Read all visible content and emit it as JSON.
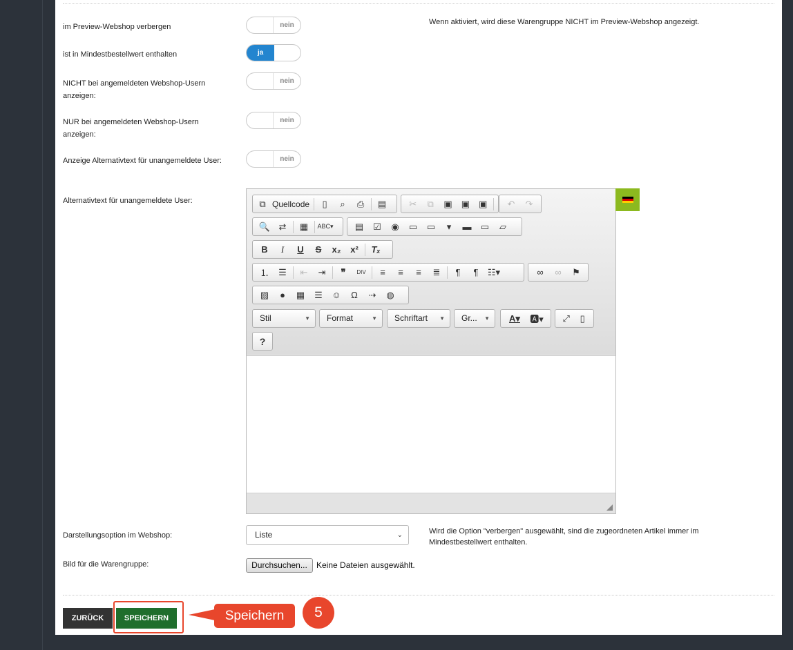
{
  "fields": {
    "preview_hide": {
      "label": "im Preview-Webshop verbergen",
      "value": "nein",
      "hint": "Wenn aktiviert, wird diese Warengruppe NICHT im Preview-Webshop angezeigt."
    },
    "min_order": {
      "label": "ist in Mindestbestellwert enthalten",
      "value": "ja"
    },
    "not_logged": {
      "label": "NICHT bei angemeldeten Webshop-Usern anzeigen:",
      "value": "nein"
    },
    "only_logged": {
      "label": "NUR bei angemeldeten Webshop-Usern anzeigen:",
      "value": "nein"
    },
    "alt_text_toggle": {
      "label": "Anzeige Alternativtext für unangemeldete User:",
      "value": "nein"
    },
    "alt_text_editor": {
      "label": "Alternativtext für unangemeldete User:"
    },
    "display_option": {
      "label": "Darstellungsoption im Webshop:",
      "value": "Liste",
      "hint": "Wird die Option \"verbergen\" ausgewählt, sind die zugeordneten Artikel immer im Mindestbestellwert enthalten."
    },
    "image": {
      "label": "Bild für die Warengruppe:",
      "button": "Durchsuchen...",
      "status": "Keine Dateien ausgewählt."
    }
  },
  "editor": {
    "source_label": "Quellcode",
    "combos": [
      "Stil",
      "Format",
      "Schriftart",
      "Gr..."
    ],
    "help": "?",
    "language_flag": "german-flag-icon"
  },
  "actions": {
    "back": "ZURÜCK",
    "save": "SPEICHERN"
  },
  "annotation": {
    "callout": "Speichern",
    "step": "5"
  },
  "colors": {
    "accent": "#2385cf",
    "save": "#1f6e2c",
    "annotation": "#e8462c",
    "flag_bg": "#8cb91f"
  }
}
